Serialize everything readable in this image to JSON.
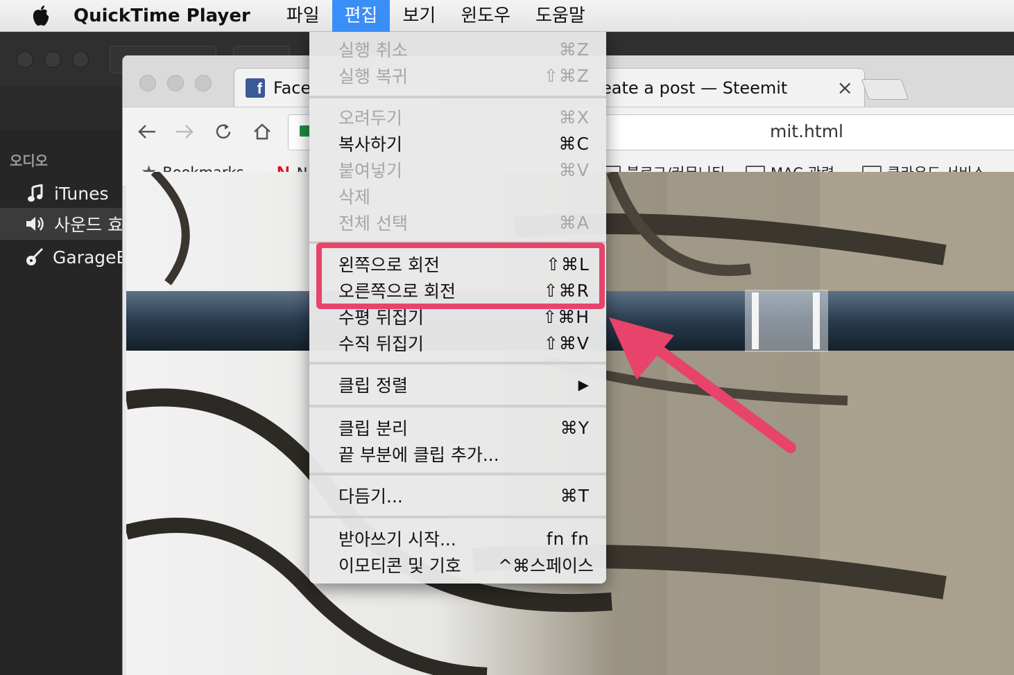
{
  "menubar": {
    "app_name": "QuickTime Player",
    "items": [
      {
        "label": "파일"
      },
      {
        "label": "편집"
      },
      {
        "label": "보기"
      },
      {
        "label": "윈도우"
      },
      {
        "label": "도움말"
      }
    ],
    "active_item": "편집"
  },
  "qt_sidebar": {
    "header": "오디오",
    "items": [
      {
        "label": "iTunes",
        "icon": "music-note-icon"
      },
      {
        "label": "사운드 효",
        "icon": "speaker-icon"
      },
      {
        "label": "GarageB",
        "icon": "guitar-icon"
      }
    ]
  },
  "chrome": {
    "tabs": [
      {
        "title": "Face",
        "icon": "facebook-icon"
      },
      {
        "title": "eate a post — Steemit",
        "close": "×"
      }
    ],
    "url": "mit.html",
    "bookmarks": [
      {
        "label": "Bookmarks",
        "icon": "star-icon"
      },
      {
        "label": "N",
        "icon": "netflix-icon"
      },
      {
        "label": "블로그/커뮤니티",
        "icon": "folder-icon"
      },
      {
        "label": "MAC 관련",
        "icon": "folder-icon"
      },
      {
        "label": "클라우드 서비스",
        "icon": "folder-icon"
      }
    ]
  },
  "edit_menu": {
    "items": [
      {
        "label": "실행 취소",
        "shortcut": "⌘Z",
        "disabled": true
      },
      {
        "label": "실행 복귀",
        "shortcut": "⇧⌘Z",
        "disabled": true
      },
      {
        "label": "오려두기",
        "shortcut": "⌘X",
        "disabled": true
      },
      {
        "label": "복사하기",
        "shortcut": "⌘C",
        "disabled": false
      },
      {
        "label": "붙여넣기",
        "shortcut": "⌘V",
        "disabled": true
      },
      {
        "label": "삭제",
        "shortcut": "",
        "disabled": true
      },
      {
        "label": "전체 선택",
        "shortcut": "⌘A",
        "disabled": true
      },
      {
        "label": "왼쪽으로 회전",
        "shortcut": "⇧⌘L",
        "disabled": false
      },
      {
        "label": "오른쪽으로 회전",
        "shortcut": "⇧⌘R",
        "disabled": false
      },
      {
        "label": "수평 뒤집기",
        "shortcut": "⇧⌘H",
        "disabled": false
      },
      {
        "label": "수직 뒤집기",
        "shortcut": "⇧⌘V",
        "disabled": false
      },
      {
        "label": "클립 정렬",
        "shortcut": "▶",
        "disabled": false
      },
      {
        "label": "클립 분리",
        "shortcut": "⌘Y",
        "disabled": false
      },
      {
        "label": "끝 부분에 클립 추가...",
        "shortcut": "",
        "disabled": false
      },
      {
        "label": "다듬기...",
        "shortcut": "⌘T",
        "disabled": false
      },
      {
        "label": "받아쓰기 시작...",
        "shortcut": "fn fn",
        "disabled": false
      },
      {
        "label": "이모티콘 및 기호",
        "shortcut": "^⌘스페이스",
        "disabled": false
      }
    ]
  },
  "colors": {
    "menu_highlight": "#3a8ef7",
    "annotation": "#e8436b"
  }
}
